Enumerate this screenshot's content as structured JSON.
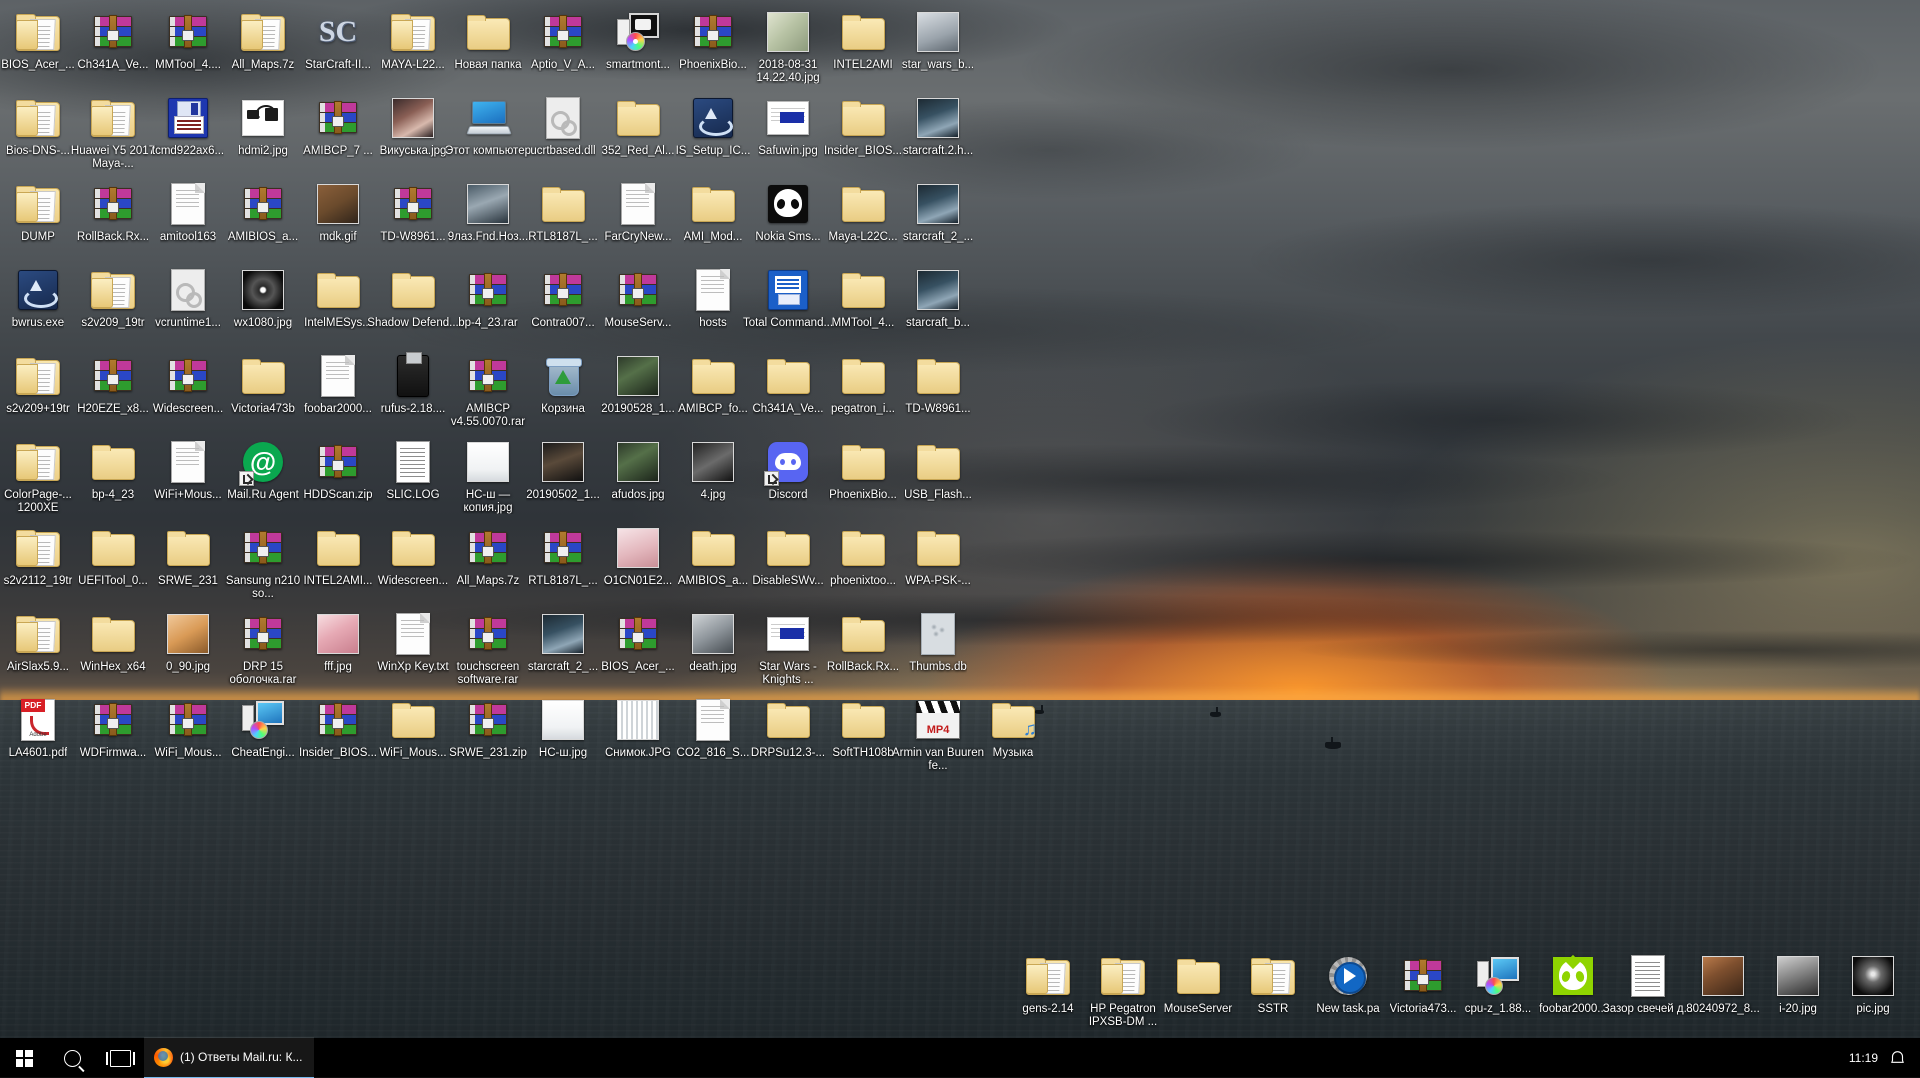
{
  "desktop": {
    "wallpaper_description": "Stormy dark clouds over sea with orange sunset on horizon",
    "colors": {
      "taskbar": "#000000",
      "label_text": "#ffffff",
      "accent": "#76b9ed",
      "folder": "#f0d28a",
      "winrar_magenta": "#c0399a",
      "winrar_blue": "#2a47c6",
      "winrar_green": "#2e9c2e"
    },
    "icons": [
      {
        "label": "BIOS_Acer_...",
        "type": "folder",
        "col": 0,
        "row": 0
      },
      {
        "label": "Ch341A_Ve...",
        "type": "rar",
        "col": 1,
        "row": 0
      },
      {
        "label": "MMTool_4....",
        "type": "rar",
        "col": 2,
        "row": 0
      },
      {
        "label": "All_Maps.7z",
        "type": "folder",
        "col": 3,
        "row": 0
      },
      {
        "label": "StarCraft-II...",
        "type": "starcraft",
        "col": 4,
        "row": 0
      },
      {
        "label": "MAYA-L22...",
        "type": "folder",
        "col": 5,
        "row": 0
      },
      {
        "label": "Новая папка",
        "type": "folder2",
        "col": 6,
        "row": 0
      },
      {
        "label": "Aptio_V_A...",
        "type": "rar",
        "col": 7,
        "row": 0
      },
      {
        "label": "smartmont...",
        "type": "smart",
        "col": 8,
        "row": 0
      },
      {
        "label": "PhoenixBio...",
        "type": "rar",
        "col": 9,
        "row": 0
      },
      {
        "label": "2018-08-31 14.22.40.jpg",
        "type": "photo",
        "col": 10,
        "row": 0,
        "photo": "banknote"
      },
      {
        "label": "INTEL2AMI",
        "type": "folder2",
        "col": 11,
        "row": 0
      },
      {
        "label": "star_wars_b...",
        "type": "photo",
        "col": 12,
        "row": 0,
        "photo": "grayfig"
      },
      {
        "label": "Bios-DNS-...",
        "type": "folder",
        "col": 0,
        "row": 1
      },
      {
        "label": "Huawei Y5 2017 Maya-...",
        "type": "folder",
        "col": 1,
        "row": 1
      },
      {
        "label": "tcmd922ax6...",
        "type": "floppy",
        "col": 2,
        "row": 1
      },
      {
        "label": "hdmi2.jpg",
        "type": "hdmi",
        "col": 3,
        "row": 1
      },
      {
        "label": "AMIBCP_7 ...",
        "type": "rar",
        "col": 4,
        "row": 1
      },
      {
        "label": "Викуська.jpg",
        "type": "photo",
        "col": 5,
        "row": 1,
        "photo": "portrait"
      },
      {
        "label": "Этот компьютер",
        "type": "pc",
        "col": 6,
        "row": 1
      },
      {
        "label": "ucrtbased.dll",
        "type": "dll",
        "col": 7,
        "row": 1
      },
      {
        "label": "352_Red_Al...",
        "type": "folder2",
        "col": 8,
        "row": 1
      },
      {
        "label": "IS_Setup_IC...",
        "type": "is",
        "col": 9,
        "row": 1
      },
      {
        "label": "Safuwin.jpg",
        "type": "window",
        "col": 10,
        "row": 1
      },
      {
        "label": "Insider_BIOS...",
        "type": "folder2",
        "col": 11,
        "row": 1
      },
      {
        "label": "starcraft.2.h...",
        "type": "photo",
        "col": 12,
        "row": 1,
        "photo": "screen"
      },
      {
        "label": "DUMP",
        "type": "folder",
        "col": 0,
        "row": 2
      },
      {
        "label": "RollBack.Rx...",
        "type": "rar",
        "col": 1,
        "row": 2
      },
      {
        "label": "amitool163",
        "type": "doc",
        "col": 2,
        "row": 2
      },
      {
        "label": "AMIBIOS_a...",
        "type": "rar",
        "col": 3,
        "row": 2
      },
      {
        "label": "mdk.gif",
        "type": "photo",
        "col": 4,
        "row": 2,
        "photo": "terrain"
      },
      {
        "label": "TD-W8961...",
        "type": "rar",
        "col": 5,
        "row": 2
      },
      {
        "label": "9лаз.Fnd.Hoз...",
        "type": "photo",
        "col": 6,
        "row": 2,
        "photo": "plane"
      },
      {
        "label": "RTL8187L_...",
        "type": "folder2",
        "col": 7,
        "row": 2
      },
      {
        "label": "FarCryNew...",
        "type": "doc",
        "col": 8,
        "row": 2
      },
      {
        "label": "AMI_Mod...",
        "type": "folder2",
        "col": 9,
        "row": 2
      },
      {
        "label": "Nokia Sms...",
        "type": "alien2",
        "col": 10,
        "row": 2
      },
      {
        "label": "Maya-L22C...",
        "type": "folder2",
        "col": 11,
        "row": 2
      },
      {
        "label": "starcraft_2_...",
        "type": "photo",
        "col": 12,
        "row": 2,
        "photo": "screen"
      },
      {
        "label": "bwrus.exe",
        "type": "is",
        "col": 0,
        "row": 3
      },
      {
        "label": "s2v209_19tr",
        "type": "folder",
        "col": 1,
        "row": 3
      },
      {
        "label": "vcruntime1...",
        "type": "dll",
        "col": 2,
        "row": 3
      },
      {
        "label": "wx1080.jpg",
        "type": "photo",
        "col": 3,
        "row": 3,
        "photo": "disc"
      },
      {
        "label": "IntelMESys...",
        "type": "folder2",
        "col": 4,
        "row": 3
      },
      {
        "label": "Shadow Defend...",
        "type": "folder2",
        "col": 5,
        "row": 3
      },
      {
        "label": "bp-4_23.rar",
        "type": "rar",
        "col": 6,
        "row": 3
      },
      {
        "label": "Contra007...",
        "type": "rar",
        "col": 7,
        "row": 3
      },
      {
        "label": "MouseServ...",
        "type": "rar",
        "col": 8,
        "row": 3
      },
      {
        "label": "hosts",
        "type": "doc",
        "col": 9,
        "row": 3
      },
      {
        "label": "Total Command...",
        "type": "totalcmd",
        "col": 10,
        "row": 3
      },
      {
        "label": "MMTool_4...",
        "type": "folder2",
        "col": 11,
        "row": 3
      },
      {
        "label": "starcraft_b...",
        "type": "photo",
        "col": 12,
        "row": 3,
        "photo": "screen"
      },
      {
        "label": "s2v209+19tr",
        "type": "folder",
        "col": 0,
        "row": 4
      },
      {
        "label": "H20EZE_x8...",
        "type": "rar",
        "col": 1,
        "row": 4
      },
      {
        "label": "Widescreen...",
        "type": "rar",
        "col": 2,
        "row": 4
      },
      {
        "label": "Victoria473b",
        "type": "folder2",
        "col": 3,
        "row": 4
      },
      {
        "label": "foobar2000...",
        "type": "doc",
        "col": 4,
        "row": 4
      },
      {
        "label": "rufus-2.18....",
        "type": "usb",
        "col": 5,
        "row": 4
      },
      {
        "label": "AMIBCP v4.55.0070.rar",
        "type": "rar",
        "col": 6,
        "row": 4
      },
      {
        "label": "Корзина",
        "type": "bin",
        "col": 7,
        "row": 4
      },
      {
        "label": "20190528_1...",
        "type": "photo",
        "col": 8,
        "row": 4,
        "photo": "board"
      },
      {
        "label": "AMIBCP_fo...",
        "type": "folder2",
        "col": 9,
        "row": 4
      },
      {
        "label": "Ch341A_Ve...",
        "type": "folder2",
        "col": 10,
        "row": 4
      },
      {
        "label": "pegatron_i...",
        "type": "folder2",
        "col": 11,
        "row": 4
      },
      {
        "label": "TD-W8961...",
        "type": "folder2",
        "col": 12,
        "row": 4
      },
      {
        "label": "ColorPage-... 1200XE",
        "type": "folder",
        "col": 0,
        "row": 5
      },
      {
        "label": "bp-4_23",
        "type": "folder2",
        "col": 1,
        "row": 5
      },
      {
        "label": "WiFi+Mous...",
        "type": "doc",
        "col": 2,
        "row": 5
      },
      {
        "label": "Mail.Ru Agent",
        "type": "mailru",
        "col": 3,
        "row": 5,
        "shortcut": true
      },
      {
        "label": "HDDScan.zip",
        "type": "rar",
        "col": 4,
        "row": 5
      },
      {
        "label": "SLIC.LOG",
        "type": "log",
        "col": 5,
        "row": 5
      },
      {
        "label": "НС-ш — копия.jpg",
        "type": "photo",
        "col": 6,
        "row": 5,
        "photo": "paper"
      },
      {
        "label": "20190502_1...",
        "type": "photo",
        "col": 7,
        "row": 5,
        "photo": "dark"
      },
      {
        "label": "afudos.jpg",
        "type": "photo",
        "col": 8,
        "row": 5,
        "photo": "board"
      },
      {
        "label": "4.jpg",
        "type": "photo",
        "col": 9,
        "row": 5,
        "photo": "dark2"
      },
      {
        "label": "Discord",
        "type": "discord",
        "col": 10,
        "row": 5,
        "shortcut": true
      },
      {
        "label": "PhoenixBio...",
        "type": "folder2",
        "col": 11,
        "row": 5
      },
      {
        "label": "USB_Flash...",
        "type": "folder2",
        "col": 12,
        "row": 5
      },
      {
        "label": "s2v2112_19tr",
        "type": "folder",
        "col": 0,
        "row": 6
      },
      {
        "label": "UEFITool_0...",
        "type": "folder2",
        "col": 1,
        "row": 6
      },
      {
        "label": "SRWE_231",
        "type": "folder2",
        "col": 2,
        "row": 6
      },
      {
        "label": "Sansung n210 so...",
        "type": "rar",
        "col": 3,
        "row": 6
      },
      {
        "label": "INTEL2AMI...",
        "type": "folder2",
        "col": 4,
        "row": 6
      },
      {
        "label": "Widescreen...",
        "type": "folder2",
        "col": 5,
        "row": 6
      },
      {
        "label": "All_Maps.7z",
        "type": "rar",
        "col": 6,
        "row": 6
      },
      {
        "label": "RTL8187L_...",
        "type": "rar",
        "col": 7,
        "row": 6
      },
      {
        "label": "O1CN01E2...",
        "type": "photo",
        "col": 8,
        "row": 6,
        "photo": "pinkbox"
      },
      {
        "label": "AMIBIOS_a...",
        "type": "folder2",
        "col": 9,
        "row": 6
      },
      {
        "label": "DisableSWv...",
        "type": "folder2",
        "col": 10,
        "row": 6
      },
      {
        "label": "phoenixtoo...",
        "type": "folder2",
        "col": 11,
        "row": 6
      },
      {
        "label": "WPA-PSK-...",
        "type": "folder2",
        "col": 12,
        "row": 6
      },
      {
        "label": "AirSlax5.9...",
        "type": "folder",
        "col": 0,
        "row": 7
      },
      {
        "label": "WinHex_x64",
        "type": "folder2",
        "col": 1,
        "row": 7
      },
      {
        "label": "0_90.jpg",
        "type": "photo",
        "col": 2,
        "row": 7,
        "photo": "orange"
      },
      {
        "label": "DRP 15 оболочка.rar",
        "type": "rar",
        "col": 3,
        "row": 7
      },
      {
        "label": "fff.jpg",
        "type": "photo",
        "col": 4,
        "row": 7,
        "photo": "pinkfood"
      },
      {
        "label": "WinXp Key.txt",
        "type": "doc",
        "col": 5,
        "row": 7
      },
      {
        "label": "touchscreen software.rar",
        "type": "rar",
        "col": 6,
        "row": 7
      },
      {
        "label": "starcraft_2_...",
        "type": "photo",
        "col": 7,
        "row": 7,
        "photo": "screen"
      },
      {
        "label": "BIOS_Acer_...",
        "type": "rar",
        "col": 8,
        "row": 7
      },
      {
        "label": "death.jpg",
        "type": "photo",
        "col": 9,
        "row": 7,
        "photo": "gray"
      },
      {
        "label": "Star Wars - Knights ...",
        "type": "window",
        "col": 10,
        "row": 7
      },
      {
        "label": "RollBack.Rx...",
        "type": "folder2",
        "col": 11,
        "row": 7
      },
      {
        "label": "Thumbs.db",
        "type": "thumbs",
        "col": 12,
        "row": 7
      },
      {
        "label": "LA4601.pdf",
        "type": "pdf",
        "col": 0,
        "row": 8
      },
      {
        "label": "WDFirmwa...",
        "type": "rar",
        "col": 1,
        "row": 8
      },
      {
        "label": "WiFi_Mous...",
        "type": "rar",
        "col": 2,
        "row": 8
      },
      {
        "label": "CheatEngi...",
        "type": "cpuz",
        "col": 3,
        "row": 8
      },
      {
        "label": "Insider_BIOS...",
        "type": "rar",
        "col": 4,
        "row": 8
      },
      {
        "label": "WiFi_Mous...",
        "type": "folder2",
        "col": 5,
        "row": 8
      },
      {
        "label": "SRWE_231.zip",
        "type": "rar",
        "col": 6,
        "row": 8
      },
      {
        "label": "НС-ш.jpg",
        "type": "photo",
        "col": 7,
        "row": 8,
        "photo": "paper"
      },
      {
        "label": "Снимок.JPG",
        "type": "photo",
        "col": 8,
        "row": 8,
        "photo": "chart"
      },
      {
        "label": "CO2_816_S...",
        "type": "doc",
        "col": 9,
        "row": 8
      },
      {
        "label": "DRPSu12.3-...",
        "type": "folder2",
        "col": 10,
        "row": 8
      },
      {
        "label": "SoftTH108b",
        "type": "folder2",
        "col": 11,
        "row": 8
      },
      {
        "label": "Armin van Buuren fe...",
        "type": "mp4",
        "col": 12,
        "row": 8
      },
      {
        "label": "Музыка",
        "type": "music",
        "col": 13,
        "row": 8
      }
    ],
    "bottom_icons": [
      {
        "label": "gens-2.14",
        "type": "folder"
      },
      {
        "label": "HP Pegatron IPXSB-DM ...",
        "type": "folder"
      },
      {
        "label": "MouseServer",
        "type": "folder2"
      },
      {
        "label": "SSTR",
        "type": "folder"
      },
      {
        "label": "New task.pa",
        "type": "gear"
      },
      {
        "label": "Victoria473...",
        "type": "rar"
      },
      {
        "label": "cpu-z_1.88...",
        "type": "cpuz"
      },
      {
        "label": "foobar2000...",
        "type": "alien"
      },
      {
        "label": "Зазор свечей д...",
        "type": "log"
      },
      {
        "label": "80240972_8...",
        "type": "photo",
        "photo": "room"
      },
      {
        "label": "i-20.jpg",
        "type": "photo",
        "photo": "portrait2"
      },
      {
        "label": "pic.jpg",
        "type": "photo",
        "photo": "darkface"
      }
    ]
  },
  "taskbar": {
    "start_label": "Start",
    "search_label": "Search",
    "taskview_label": "Task View",
    "tasks": [
      {
        "label": "(1) Ответы Mail.ru: К...",
        "app": "firefox",
        "active": true
      }
    ],
    "clock": "11:19",
    "notification_label": "Notifications"
  }
}
